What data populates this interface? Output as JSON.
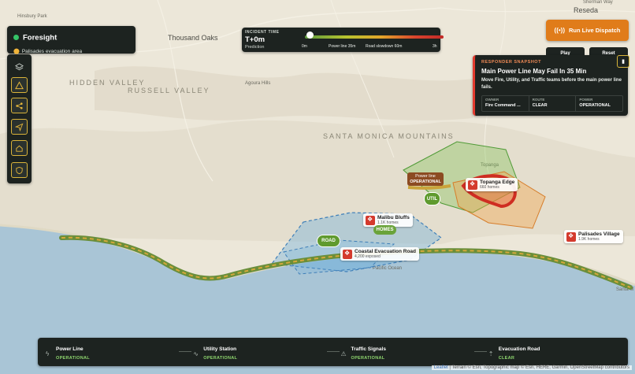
{
  "brand": {
    "title": "Foresight",
    "subtitle": "Palisades evacuation area"
  },
  "toolbar": {
    "icons": [
      "layers-icon",
      "warning-icon",
      "network-icon",
      "navigate-icon",
      "home-icon",
      "shield-icon"
    ]
  },
  "incident": {
    "label": "INCIDENT TIME",
    "value": "T+0m",
    "sublabel": "Prediction",
    "ticks": [
      "0m",
      "Power line 35m",
      "Road slowdown 60m",
      "3h"
    ],
    "progress_fraction": 0.0
  },
  "dispatch": {
    "label": "Run Live Dispatch",
    "play": "Play",
    "reset": "Reset"
  },
  "snapshot": {
    "label": "RESPONDER SNAPSHOT",
    "title": "Main Power Line May Fail In 35 Min",
    "description": "Move Fire, Utility, and Traffic teams before the main power line fails.",
    "cells": [
      {
        "key": "OWNER",
        "value": "Fire Command ..."
      },
      {
        "key": "ROUTE",
        "value": "CLEAR"
      },
      {
        "key": "POWER",
        "value": "OPERATIONAL"
      }
    ]
  },
  "map": {
    "region_label": "SANTA MONICA MOUNTAINS",
    "valley_label": "HIDDEN VALLEY",
    "russell_label": "RUSSELL VALLEY",
    "city_thousand_oaks": "Thousand Oaks",
    "city_reseda": "Reseda",
    "street_hinsbury": "Hinsbury Park",
    "street_sherman": "Sherman Way",
    "place_agoura": "Agoura Hills",
    "place_topanga": "Topanga",
    "place_pacific": "Pacific Ocean",
    "place_santa": "Santa M"
  },
  "callouts": {
    "topanga": {
      "name": "Topanga Edge",
      "sub": "660 homes"
    },
    "malibu": {
      "name": "Malibu Bluffs",
      "sub": "1.1K homes"
    },
    "coastal": {
      "name": "Coastal Evacuation Road",
      "sub": "4,200 exposed"
    },
    "palisades": {
      "name": "Palisades Village",
      "sub": "1.9K homes"
    }
  },
  "assets": {
    "powerline_tag_name": "Power line",
    "powerline_tag_status": "OPERATIONAL",
    "util": "UTIL",
    "homes": "HOMES",
    "road": "ROAD"
  },
  "status": [
    {
      "name": "Power Line",
      "value": "OPERATIONAL",
      "icon": "lightning-icon"
    },
    {
      "name": "Utility Station",
      "value": "OPERATIONAL",
      "icon": "pulse-icon"
    },
    {
      "name": "Traffic Signals",
      "value": "OPERATIONAL",
      "icon": "traffic-icon"
    },
    {
      "name": "Evacuation Road",
      "value": "CLEAR",
      "icon": "road-icon"
    }
  ],
  "attribution": {
    "leaflet": "Leaflet",
    "rest": "| Terrain © Esri, Topographic map © Esri, HERE, Garmin, OpenStreetMap contributors"
  },
  "colors": {
    "accent": "#e07c1a",
    "alert": "#e23b2f",
    "ok": "#8ed66e",
    "panel": "#1d2320"
  }
}
